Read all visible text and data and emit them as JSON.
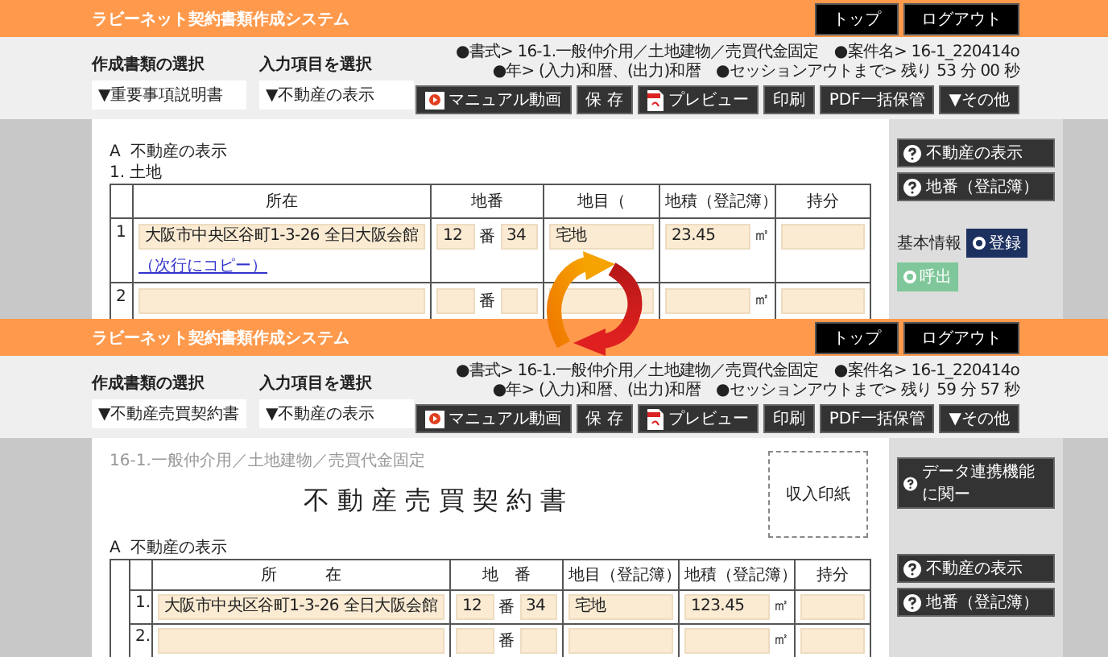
{
  "screens": [
    {
      "app_title": "ラビーネット契約書類作成システム",
      "nav_buttons": [
        "トップ",
        "ログアウト"
      ],
      "selectors": [
        {
          "label": "作成書類の選択",
          "value": "▼重要事項説明書"
        },
        {
          "label": "入力項目を選択",
          "value": "▼不動産の表示"
        }
      ],
      "info_lines": [
        "●書式> 16-1.一般仲介用／土地建物／売買代金固定　●案件名> 16-1_220414o",
        "●年> (入力)和暦、(出力)和暦　●セッションアウトまで> 残り 53 分 00 秒"
      ],
      "toolbar": [
        {
          "label": "マニュアル動画",
          "kind": "video"
        },
        {
          "label": "保 存",
          "kind": "plain"
        },
        {
          "label": "プレビュー",
          "kind": "pdf"
        },
        {
          "label": "印刷",
          "kind": "plain"
        },
        {
          "label": "PDF一括保管",
          "kind": "plain"
        },
        {
          "label": "▼その他",
          "kind": "plain"
        }
      ],
      "document": {
        "section": "A  不動産の表示",
        "subsection": "1. 土地",
        "table": {
          "columns": [
            "所在",
            "地番",
            "地目（",
            "地積（登記簿）",
            "持分"
          ],
          "rows": [
            {
              "number": "1",
              "location": "大阪市中央区谷町1-3-26 全日大阪会館",
              "copy_link": "（次行にコピー）",
              "lot": "12",
              "lot_separator": "番",
              "lot_sub": "34",
              "category": "宅地",
              "area": "23.45",
              "unit": "㎡"
            },
            {
              "number": "2",
              "lot_separator": "番",
              "unit": "㎡"
            }
          ]
        }
      },
      "side_panel": {
        "help_buttons": [
          "不動産の表示",
          "地番（登記簿）"
        ],
        "basic_info": {
          "label": "基本情報",
          "buttons": [
            {
              "label": "登録",
              "kind": "register"
            },
            {
              "label": "呼出",
              "kind": "recall"
            }
          ]
        }
      }
    },
    {
      "app_title": "ラビーネット契約書類作成システム",
      "nav_buttons": [
        "トップ",
        "ログアウト"
      ],
      "selectors": [
        {
          "label": "作成書類の選択",
          "value": "▼不動産売買契約書"
        },
        {
          "label": "入力項目を選択",
          "value": "▼不動産の表示"
        }
      ],
      "info_lines": [
        "●書式> 16-1.一般仲介用／土地建物／売買代金固定　●案件名> 16-1_220414o",
        "●年> (入力)和暦、(出力)和暦　●セッションアウトまで> 残り 59 分 57 秒"
      ],
      "toolbar": [
        {
          "label": "マニュアル動画",
          "kind": "video"
        },
        {
          "label": "保 存",
          "kind": "plain"
        },
        {
          "label": "プレビュー",
          "kind": "pdf"
        },
        {
          "label": "印刷",
          "kind": "plain"
        },
        {
          "label": "PDF一括保管",
          "kind": "plain"
        },
        {
          "label": "▼その他",
          "kind": "plain"
        }
      ],
      "document": {
        "breadcrumb": "16-1.一般仲介用／土地建物／売買代金固定",
        "title": "不動産売買契約書",
        "stamp": "収入印紙",
        "section": "A  不動産の表示",
        "table": {
          "lead_column": true,
          "columns": [
            "所　　　在",
            "地　番",
            "地目（登記簿）",
            "地積（登記簿）",
            "持分"
          ],
          "rows": [
            {
              "number": "1.",
              "location": "大阪市中央区谷町1-3-26 全日大阪会館",
              "lot": "12",
              "lot_separator": "番",
              "lot_sub": "34",
              "category": "宅地",
              "area": "123.45",
              "unit": "㎡"
            },
            {
              "number": "2.",
              "lot_separator": "番",
              "unit": "㎡"
            }
          ]
        }
      },
      "side_panel": {
        "link_button": "データ連携機能に関ー",
        "help_buttons": [
          "不動産の表示",
          "地番（登記簿）"
        ]
      }
    }
  ]
}
